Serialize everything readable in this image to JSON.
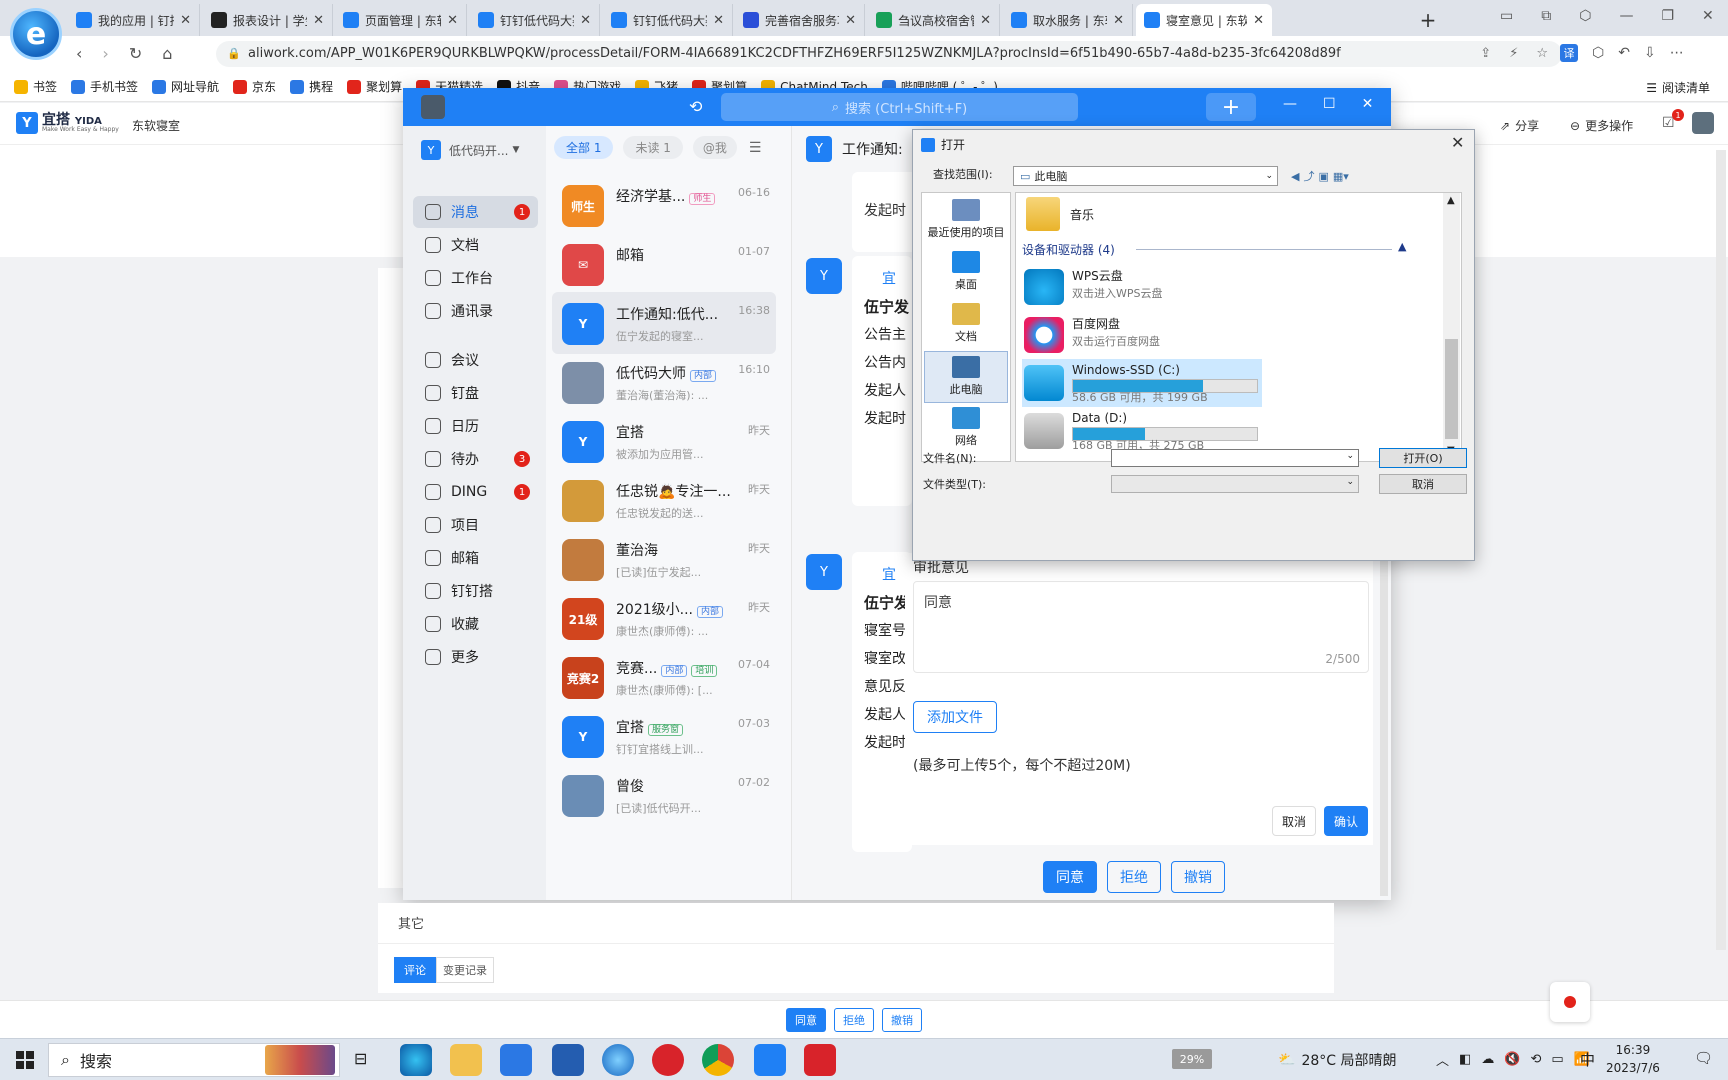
{
  "browser": {
    "tabs": [
      {
        "label": "我的应用 | 钉搭",
        "color": "#1f80f5"
      },
      {
        "label": "报表设计 | 学生",
        "color": "#222"
      },
      {
        "label": "页面管理 | 东软",
        "color": "#1f80f5"
      },
      {
        "label": "钉钉低代码大赛",
        "color": "#1f80f5"
      },
      {
        "label": "钉钉低代码大赛",
        "color": "#1f80f5"
      },
      {
        "label": "完善宿舍服务功",
        "color": "#2b4fd8"
      },
      {
        "label": "刍议高校宿舍管",
        "color": "#18a058"
      },
      {
        "label": "取水服务 | 东软",
        "color": "#1f80f5"
      },
      {
        "label": "寝室意见 | 东软",
        "color": "#1f80f5",
        "active": true
      }
    ],
    "new_tab": "+",
    "url": "aliwork.com/APP_W01K6PER9QURKBLWPQKW/processDetail/FORM-4IA66891KC2CDFTHFZH69ERF5I125WZNKMJLA?procInsId=6f51b490-65b7-4a8d-b235-3fc64208d89f",
    "translate_label": "译",
    "bookmarks": [
      {
        "label": "书签",
        "color": "#f5b400"
      },
      {
        "label": "手机书签",
        "color": "#2b78e4"
      },
      {
        "label": "网址导航",
        "color": "#2b78e4"
      },
      {
        "label": "京东",
        "color": "#e1251b"
      },
      {
        "label": "携程",
        "color": "#2b78e4"
      },
      {
        "label": "聚划算",
        "color": "#e1251b"
      },
      {
        "label": "天猫精选",
        "color": "#e1251b"
      },
      {
        "label": "抖音",
        "color": "#111"
      },
      {
        "label": "热门游戏",
        "color": "#e0508f"
      },
      {
        "label": "飞猪",
        "color": "#f5b400"
      },
      {
        "label": "聚划算",
        "color": "#e1251b"
      },
      {
        "label": "ChatMind Tech",
        "color": "#f5b400"
      },
      {
        "label": "哔哩哔哩 ( ゜- ゜)",
        "color": "#2b78e4"
      }
    ],
    "reading_list": "阅读清单"
  },
  "yida": {
    "logo": "宜搭",
    "logo_en": "YIDA",
    "logo_sub": "Make Work Easy & Happy",
    "org": "东软寝室",
    "share": "分享",
    "more_ops": "更多操作",
    "notif_count": "1"
  },
  "dingtalk": {
    "search_placeholder": "搜索 (Ctrl+Shift+F)",
    "org": "低代码开...",
    "filters": [
      "全部 1",
      "未读 1",
      "@我"
    ],
    "nav": [
      {
        "label": "消息",
        "badge": "1",
        "active": true
      },
      {
        "label": "文档"
      },
      {
        "label": "工作台"
      },
      {
        "label": "通讯录"
      },
      {
        "label": "会议"
      },
      {
        "label": "钉盘"
      },
      {
        "label": "日历"
      },
      {
        "label": "待办",
        "badge": "3"
      },
      {
        "label": "DING",
        "badge": "1"
      },
      {
        "label": "项目"
      },
      {
        "label": "邮箱"
      },
      {
        "label": "钉钉搭"
      },
      {
        "label": "收藏"
      },
      {
        "label": "更多"
      }
    ],
    "conversations": [
      {
        "name": "经济学基...",
        "tag": "师生",
        "tagcls": "p",
        "time": "06-16",
        "preview": "",
        "avatar_color": "#f08a24",
        "avatar_text": "师生"
      },
      {
        "name": "邮箱",
        "tag": "",
        "time": "01-07",
        "preview": "",
        "avatar_color": "#e04848",
        "avatar_text": "✉"
      },
      {
        "name": "工作通知:低代...",
        "tag": "",
        "time": "16:38",
        "preview": "伍宁发起的寝室...",
        "avatar_color": "#1f80f5",
        "avatar_text": "Y",
        "selected": true
      },
      {
        "name": "低代码大师",
        "tag": "内部",
        "tagcls": "",
        "time": "16:10",
        "preview": "董治海(董治海): ...",
        "avatar_color": "#7d8fa8",
        "avatar_text": ""
      },
      {
        "name": "宜搭",
        "tag": "",
        "time": "昨天",
        "preview": "被添加为应用管...",
        "avatar_color": "#1f80f5",
        "avatar_text": "Y"
      },
      {
        "name": "任忠锐🙇专注一...",
        "tag": "",
        "time": "昨天",
        "preview": "任忠锐发起的送...",
        "avatar_color": "#d39a3a",
        "avatar_text": ""
      },
      {
        "name": "董治海",
        "tag": "",
        "time": "昨天",
        "preview": "[已读]伍宁发起...",
        "avatar_color": "#c27b3e",
        "avatar_text": ""
      },
      {
        "name": "2021级小...",
        "tag": "内部",
        "tagcls": "",
        "time": "昨天",
        "preview": "康世杰(康师傅): ...",
        "avatar_color": "#d2451e",
        "avatar_text": "21级"
      },
      {
        "name": "竞赛...",
        "tag": "内部",
        "tag2": "培训",
        "tagcls": "",
        "time": "07-04",
        "preview": "康世杰(康师傅): [...",
        "avatar_color": "#c8421c",
        "avatar_text": "竞赛2"
      },
      {
        "name": "宜搭",
        "tag": "服务窗",
        "tagcls": "g",
        "time": "07-03",
        "preview": "钉钉宜搭线上训...",
        "avatar_color": "#1f80f5",
        "avatar_text": "Y"
      },
      {
        "name": "曾俊",
        "tag": "",
        "time": "07-02",
        "preview": "[已读]低代码开...",
        "avatar_color": "#6a8db5",
        "avatar_text": ""
      }
    ],
    "chat": {
      "title": "工作通知:",
      "launch_time_1": "发起时",
      "card1": {
        "brand": "宜",
        "title": "伍宁发",
        "lines": [
          "公告主",
          "公告内",
          "发起人",
          "发起时"
        ]
      },
      "card2": {
        "brand": "宜",
        "title": "伍宁发",
        "lines": [
          "寝室号",
          "寝室改",
          "意见反",
          "发起人",
          "发起时"
        ]
      }
    },
    "approval": {
      "label": "审批意见",
      "text": "同意",
      "counter": "2/500",
      "add_file": "添加文件",
      "hint": "(最多可上传5个，每个不超过20M)",
      "cancel": "取消",
      "confirm": "确认",
      "agree": "同意",
      "reject": "拒绝",
      "revoke": "撤销"
    }
  },
  "dialog": {
    "title": "打开",
    "lookin_label": "查找范围(I):",
    "lookin_value": "此电脑",
    "places": [
      "最近使用的项目",
      "桌面",
      "文档",
      "此电脑",
      "网络"
    ],
    "music": "音乐",
    "section": "设备和驱动器 (4)",
    "drives": [
      {
        "name": "WPS云盘",
        "sub": "双击进入WPS云盘"
      },
      {
        "name": "百度网盘",
        "sub": "双击运行百度网盘"
      },
      {
        "name": "Windows-SSD (C:)",
        "sub": "58.6 GB 可用，共 199 GB",
        "used": 0.706,
        "selected": true
      },
      {
        "name": "Data (D:)",
        "sub": "168 GB 可用，共 275 GB",
        "used": 0.389
      }
    ],
    "filename_label": "文件名(N):",
    "filetype_label": "文件类型(T):",
    "open_btn": "打开(O)",
    "cancel_btn": "取消"
  },
  "page": {
    "other": "其它",
    "tab_comment": "评论",
    "tab_history": "变更记录",
    "agree": "同意",
    "reject": "拒绝",
    "revoke": "撤销"
  },
  "taskbar": {
    "search": "搜索",
    "battery": "29%",
    "weather": "28°C 局部晴朗",
    "ime": "中",
    "time": "16:39",
    "date": "2023/7/6"
  }
}
